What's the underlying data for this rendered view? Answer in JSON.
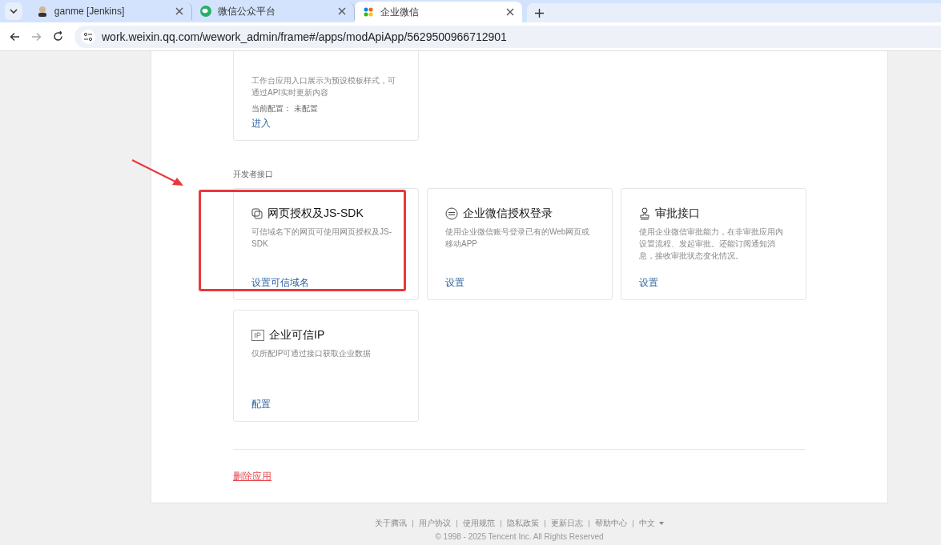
{
  "browser": {
    "tabs": [
      {
        "title": "ganme [Jenkins]",
        "selected": false
      },
      {
        "title": "微信公众平台",
        "selected": false
      },
      {
        "title": "企业微信",
        "selected": true
      }
    ],
    "url": "work.weixin.qq.com/wework_admin/frame#/apps/modApiApp/5629500966712901"
  },
  "top_card": {
    "description": "工作台应用入口展示为预设模板样式，可通过API实时更新内容",
    "config": "当前配置：  未配置",
    "link": "进入"
  },
  "section_title": "开发者接口",
  "cards": [
    {
      "kind": "webpage",
      "title": "网页授权及JS-SDK",
      "description": "可信域名下的网页可使用网页授权及JS-SDK",
      "link": "设置可信域名",
      "highlighted": true
    },
    {
      "kind": "login",
      "title": "企业微信授权登录",
      "description": "使用企业微信账号登录已有的Web网页或移动APP",
      "link": "设置",
      "highlighted": false
    },
    {
      "kind": "approval",
      "title": "审批接口",
      "description": "使用企业微信审批能力，在非审批应用内设置流程、发起审批。还能订阅通知消息，接收审批状态变化情况。",
      "link": "设置",
      "highlighted": false
    },
    {
      "kind": "ip",
      "title": "企业可信IP",
      "description": "仅所配IP可通过接口获取企业数据",
      "link": "配置",
      "highlighted": false
    }
  ],
  "delete_link": "删除应用",
  "footer": {
    "links": [
      "关于腾讯",
      "用户协议",
      "使用规范",
      "隐私政策",
      "更新日志",
      "帮助中心"
    ],
    "language": "中文",
    "copyright": "© 1998 - 2025 Tencent Inc. All Rights Reserved"
  }
}
